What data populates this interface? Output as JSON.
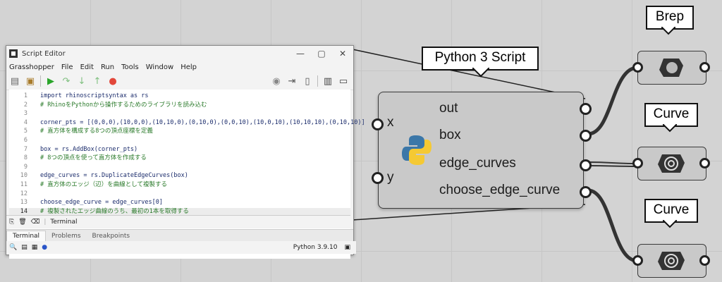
{
  "editor": {
    "title": "Script Editor",
    "menu": [
      "Grasshopper",
      "File",
      "Edit",
      "Run",
      "Tools",
      "Window",
      "Help"
    ],
    "code_lines": [
      {
        "ln": "1",
        "text": "import rhinoscriptsyntax as rs",
        "comment": false
      },
      {
        "ln": "2",
        "text": "# RhinoをPythonから操作するためのライブラリを読み込む",
        "comment": true
      },
      {
        "ln": "3",
        "text": "",
        "comment": false
      },
      {
        "ln": "4",
        "text": "corner_pts = [(0,0,0),(10,0,0),(10,10,0),(0,10,0),(0,0,10),(10,0,10),(10,10,10),(0,10,10)]",
        "comment": false
      },
      {
        "ln": "5",
        "text": "# 直方体を構成する8つの頂点座標を定義",
        "comment": true
      },
      {
        "ln": "6",
        "text": "",
        "comment": false
      },
      {
        "ln": "7",
        "text": "box = rs.AddBox(corner_pts)",
        "comment": false
      },
      {
        "ln": "8",
        "text": "# 8つの頂点を使って直方体を作成する",
        "comment": true
      },
      {
        "ln": "9",
        "text": "",
        "comment": false
      },
      {
        "ln": "10",
        "text": "edge_curves = rs.DuplicateEdgeCurves(box)",
        "comment": false
      },
      {
        "ln": "11",
        "text": "# 直方体のエッジ（辺）を曲線として複製する",
        "comment": true
      },
      {
        "ln": "12",
        "text": "",
        "comment": false
      },
      {
        "ln": "13",
        "text": "choose_edge_curve = edge_curves[0]",
        "comment": false
      },
      {
        "ln": "14",
        "text": "# 複製されたエッジ曲線のうち、最初の1本を取得する",
        "comment": true
      }
    ],
    "terminal_label": "Terminal",
    "tabs": [
      "Terminal",
      "Problems",
      "Breakpoints"
    ],
    "python_version": "Python 3.9.10"
  },
  "component": {
    "title": "Python 3 Script",
    "inputs": [
      "x",
      "y"
    ],
    "outputs": [
      "out",
      "box",
      "edge_curves",
      "choose_edge_curve"
    ]
  },
  "outputs_params": [
    {
      "label": "Brep"
    },
    {
      "label": "Curve"
    },
    {
      "label": "Curve"
    }
  ],
  "colors": {
    "canvas": "#d3d3d3",
    "component": "#c9c9c9",
    "run_green": "#2aa52a",
    "stop_red": "#e2473a"
  }
}
